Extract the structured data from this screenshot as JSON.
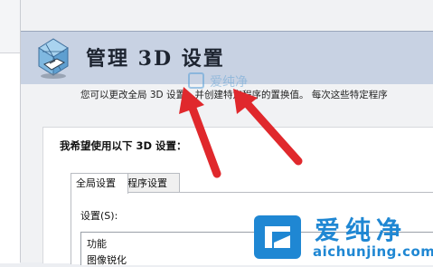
{
  "header": {
    "title": "管理 3D 设置",
    "icon": "nvidia-3d-settings-icon",
    "background": "#c8d2e3"
  },
  "description": "您可以更改全局 3D 设置，并创建特定程序的置换值。 每次这些特定程序",
  "panel": {
    "heading": "我希望使用以下 3D 设置：",
    "tabs": [
      {
        "label": "全局设置",
        "active": true
      },
      {
        "label": "程序设置",
        "active": false
      }
    ],
    "settings_label": "设置(S):",
    "list_header": "功能",
    "list_items": [
      "图像锐化"
    ]
  },
  "watermark": {
    "small_text": "爱纯净",
    "brand_text": "爱纯净",
    "brand_url": "aichunjing.com",
    "brand_color": "#1f87d3"
  },
  "annotations": {
    "arrow_color": "#e0282c",
    "arrow_count": 2
  }
}
